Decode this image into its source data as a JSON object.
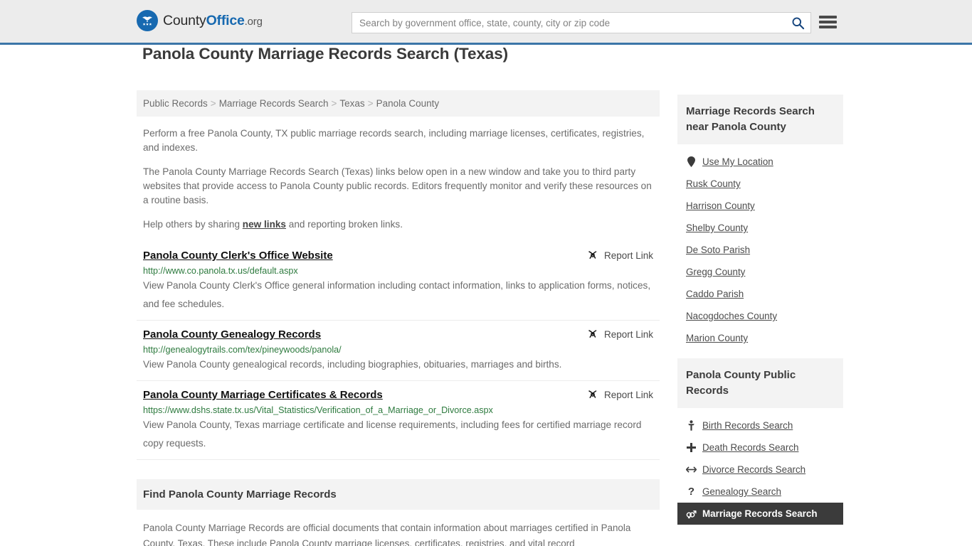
{
  "header": {
    "brand": {
      "part1": "County",
      "part2": "Office",
      "tld": ".org"
    },
    "search": {
      "placeholder": "Search by government office, state, county, city or zip code",
      "value": ""
    }
  },
  "main": {
    "title": "Panola County Marriage Records Search (Texas)",
    "breadcrumb": [
      "Public Records",
      "Marriage Records Search",
      "Texas",
      "Panola County"
    ],
    "breadcrumb_separator": ">",
    "intro": {
      "p1": "Perform a free Panola County, TX public marriage records search, including marriage licenses, certificates, registries, and indexes.",
      "p2": "The Panola County Marriage Records Search (Texas) links below open in a new window and take you to third party websites that provide access to Panola County public records. Editors frequently monitor and verify these resources on a routine basis.",
      "p3_before": "Help others by sharing ",
      "p3_link": "new links",
      "p3_after": " and reporting broken links."
    },
    "report_link_label": "Report Link",
    "results": [
      {
        "title": "Panola County Clerk's Office Website",
        "url": "http://www.co.panola.tx.us/default.aspx",
        "description": "View Panola County Clerk's Office general information including contact information, links to application forms, notices, and fee schedules."
      },
      {
        "title": "Panola County Genealogy Records",
        "url": "http://genealogytrails.com/tex/pineywoods/panola/",
        "description": "View Panola County genealogical records, including biographies, obituaries, marriages and births."
      },
      {
        "title": "Panola County Marriage Certificates & Records",
        "url": "https://www.dshs.state.tx.us/Vital_Statistics/Verification_of_a_Marriage_or_Divorce.aspx",
        "description": "View Panola County, Texas marriage certificate and license requirements, including fees for certified marriage record copy requests."
      }
    ],
    "find_section": {
      "heading": "Find Panola County Marriage Records",
      "body": "Panola County Marriage Records are official documents that contain information about marriages certified in Panola County, Texas. These include Panola County marriage licenses, certificates, registries, and vital record"
    }
  },
  "sidebar": {
    "nearby": {
      "title": "Marriage Records Search near Panola County",
      "items": [
        {
          "label": "Use My Location",
          "icon": "map-pin-icon"
        },
        {
          "label": "Rusk County",
          "icon": ""
        },
        {
          "label": "Harrison County",
          "icon": ""
        },
        {
          "label": "Shelby County",
          "icon": ""
        },
        {
          "label": "De Soto Parish",
          "icon": ""
        },
        {
          "label": "Gregg County",
          "icon": ""
        },
        {
          "label": "Caddo Parish",
          "icon": ""
        },
        {
          "label": "Nacogdoches County",
          "icon": ""
        },
        {
          "label": "Marion County",
          "icon": ""
        }
      ]
    },
    "public_records": {
      "title": "Panola County Public Records",
      "items": [
        {
          "label": "Birth Records Search",
          "icon": "baby-icon",
          "active": false
        },
        {
          "label": "Death Records Search",
          "icon": "cross-icon",
          "active": false
        },
        {
          "label": "Divorce Records Search",
          "icon": "left-right-arrow-icon",
          "active": false
        },
        {
          "label": "Genealogy Search",
          "icon": "question-mark-icon",
          "active": false
        },
        {
          "label": "Marriage Records Search",
          "icon": "gender-symbols-icon",
          "active": true
        }
      ]
    }
  },
  "colors": {
    "brand_blue": "#1769b0",
    "header_rule": "#3c76a8",
    "url_green": "#2d7a3e",
    "active_bg": "#3b3b3b",
    "panel_gray": "#f3f3f3"
  }
}
